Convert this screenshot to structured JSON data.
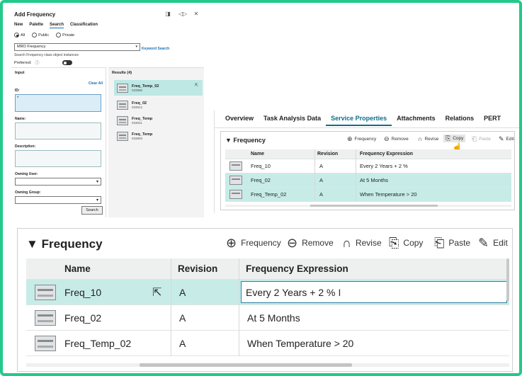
{
  "dialog": {
    "title": "Add Frequency",
    "tabs": [
      "New",
      "Palette",
      "Search",
      "Classification"
    ],
    "active_tab": "Search",
    "scope_options": [
      "All",
      "Public",
      "Private"
    ],
    "class_value": "MRO Frequency",
    "keyword_search": "Keyword Search",
    "hint": "Search Frequency class object instances",
    "preferred_label": "Preferred:",
    "input_title": "Input",
    "clear_all": "Clear All",
    "fields": {
      "id_label": "ID:",
      "id_value": "*",
      "name_label": "Name:",
      "description_label": "Description:",
      "owning_user_label": "Owning User:",
      "owning_group_label": "Owning Group:"
    },
    "search_button": "Search",
    "results_title": "Results (4)",
    "results": [
      {
        "name": "Freq_Temp_02",
        "id": "033986"
      },
      {
        "name": "Freq_02",
        "id": "033812"
      },
      {
        "name": "Freq_Temp",
        "id": "033811"
      },
      {
        "name": "Freq_Temp",
        "id": "033803"
      }
    ]
  },
  "tabs": [
    "Overview",
    "Task Analysis Data",
    "Service Properties",
    "Attachments",
    "Relations",
    "PERT"
  ],
  "active_tab": "Service Properties",
  "section": {
    "title": "▼ Frequency",
    "toolbar": {
      "frequency": "Frequency",
      "remove": "Remove",
      "revise": "Revise",
      "copy": "Copy",
      "paste": "Paste",
      "edit": "Edit"
    },
    "columns": {
      "name": "Name",
      "revision": "Revision",
      "expression": "Frequency Expression"
    },
    "rows": [
      {
        "name": "Freq_10",
        "revision": "A",
        "expression": "Every 2 Years + 2 %"
      },
      {
        "name": "Freq_02",
        "revision": "A",
        "expression": "At 5 Months"
      },
      {
        "name": "Freq_Temp_02",
        "revision": "A",
        "expression": "When Temperature > 20"
      }
    ]
  },
  "zoom": {
    "title": "Frequency",
    "editing_value": "Every 2 Years + 2 %"
  }
}
